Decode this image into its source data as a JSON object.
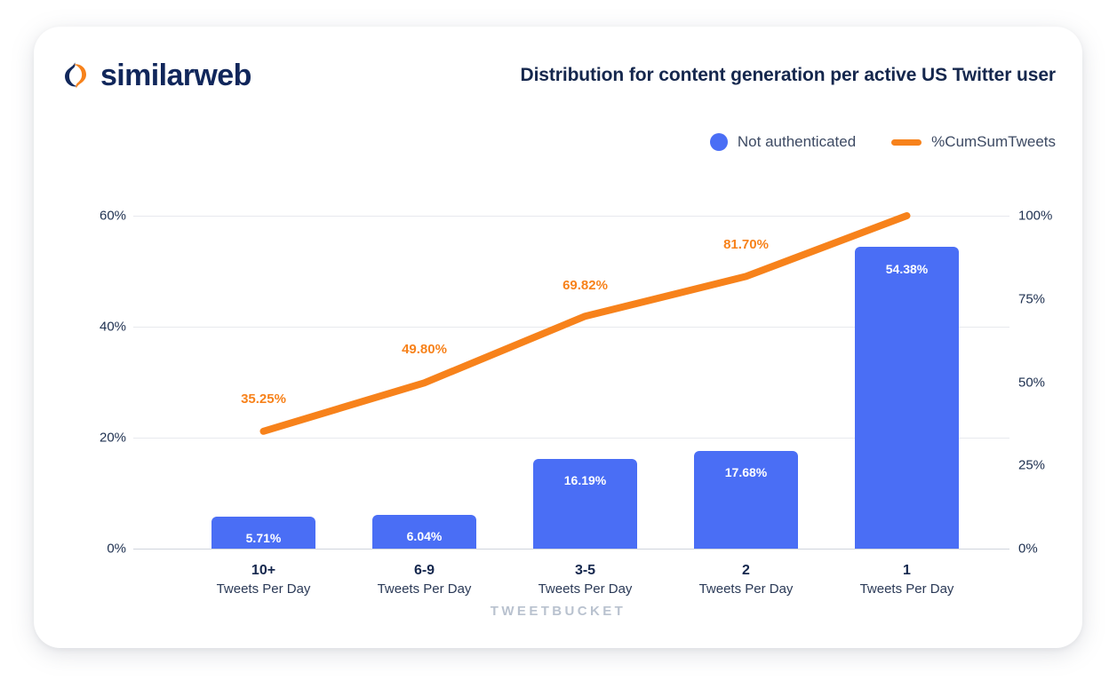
{
  "brand": {
    "name": "similarweb",
    "logo_icon": "similarweb-droplet-logo",
    "navy": "#11275b",
    "orange": "#f7821b"
  },
  "header": {
    "title": "Distribution for content generation per active US Twitter user"
  },
  "legend": {
    "items": [
      {
        "label": "Not authenticated",
        "marker": "circle",
        "color": "#4a6ef5"
      },
      {
        "label": "%CumSumTweets",
        "marker": "line",
        "color": "#f7821b"
      }
    ]
  },
  "axis": {
    "left_ticks": [
      "60%",
      "40%",
      "20%",
      "0%"
    ],
    "right_ticks": [
      "100%",
      "75%",
      "50%",
      "25%",
      "0%"
    ],
    "x_title": "TWEETBUCKET"
  },
  "chart_data": {
    "type": "bar",
    "title": "Distribution for content generation per active US Twitter user",
    "xlabel": "TWEETBUCKET",
    "ylabel": "",
    "grid": true,
    "legend_position": "top-right",
    "categories": [
      "10+",
      "6-9",
      "3-5",
      "2",
      "1"
    ],
    "category_sublabel": "Tweets Per Day",
    "ylim": [
      0,
      60
    ],
    "y2lim": [
      0,
      100
    ],
    "yticks": [
      0,
      20,
      40,
      60
    ],
    "y2ticks": [
      0,
      25,
      50,
      75,
      100
    ],
    "series": [
      {
        "name": "Not authenticated",
        "type": "bar",
        "axis": "left",
        "color": "#4a6ef5",
        "values": [
          5.71,
          6.04,
          16.19,
          17.68,
          54.38
        ],
        "labels": [
          "5.71%",
          "6.04%",
          "16.19%",
          "17.68%",
          "54.38%"
        ]
      },
      {
        "name": "%CumSumTweets",
        "type": "line",
        "axis": "right",
        "color": "#f7821b",
        "values": [
          35.25,
          49.8,
          69.82,
          81.7,
          100.0
        ],
        "labels": [
          "35.25%",
          "49.80%",
          "69.82%",
          "81.70%",
          ""
        ]
      }
    ]
  }
}
